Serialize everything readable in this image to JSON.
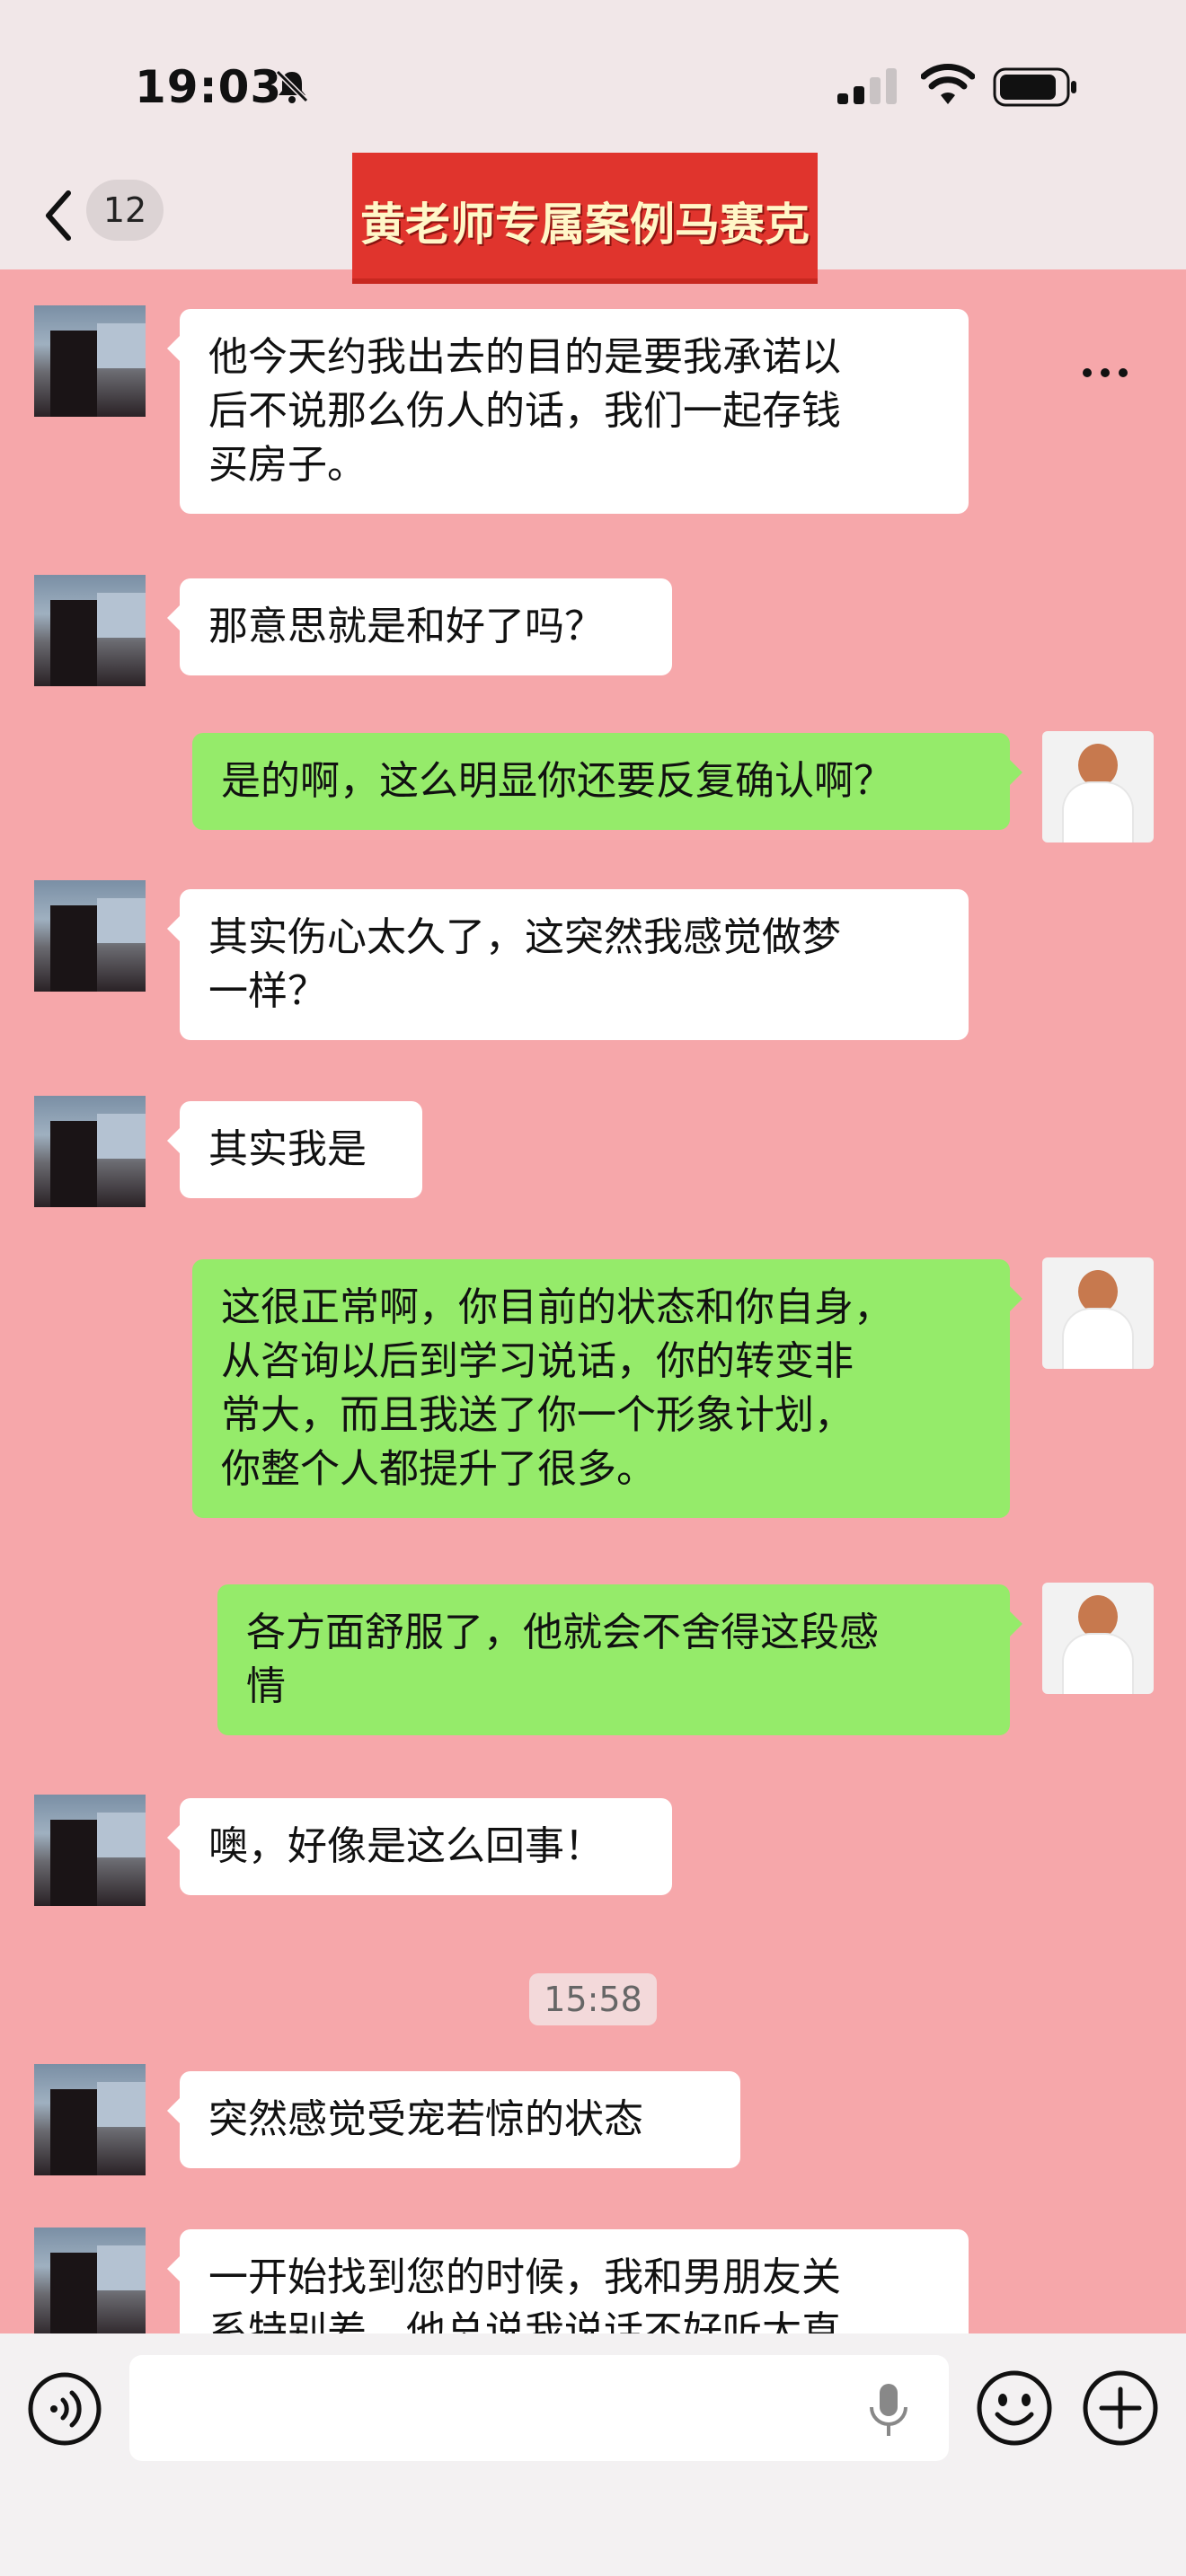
{
  "status_bar": {
    "time": "19:03",
    "icons": [
      "bell-slash-icon",
      "signal-icon",
      "wifi-icon",
      "battery-icon"
    ]
  },
  "header": {
    "back_icon": "chevron-left-icon",
    "unread_count": "12",
    "banner_title": "黄老师专属案例马赛克",
    "more_icon": "more-icon"
  },
  "messages": [
    {
      "side": "left",
      "text": "他今天约我出去的目的是要我承诺以\n后不说那么伤人的话，我们一起存钱\n买房子。"
    },
    {
      "side": "left",
      "text": "那意思就是和好了吗？"
    },
    {
      "side": "right",
      "text": "是的啊，这么明显你还要反复确认啊？"
    },
    {
      "side": "left",
      "text": "其实伤心太久了，这突然我感觉做梦\n一样？"
    },
    {
      "side": "left",
      "text": "其实我是"
    },
    {
      "side": "right",
      "text": "这很正常啊，你目前的状态和你自身，\n从咨询以后到学习说话，你的转变非\n常大，而且我送了你一个形象计划，\n你整个人都提升了很多。"
    },
    {
      "side": "right",
      "text": "各方面舒服了，他就会不舍得这段感\n情"
    },
    {
      "side": "left",
      "text": "噢，好像是这么回事！"
    },
    {
      "side": "left",
      "text": "突然感觉受宠若惊的状态"
    },
    {
      "side": "left",
      "text": "一开始找到您的时候，我和男朋友关\n系特别差，他总说我说话不好听太直"
    }
  ],
  "timestamp": "15:58",
  "input_bar": {
    "voice_icon": "voice-icon",
    "input_value": "",
    "mic_icon": "mic-icon",
    "emoji_icon": "emoji-icon",
    "plus_icon": "plus-icon"
  }
}
